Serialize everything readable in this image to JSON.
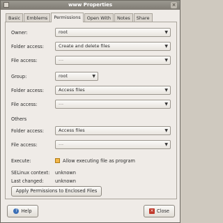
{
  "window": {
    "title": "www Properties",
    "close_glyph": "×"
  },
  "tabs": [
    {
      "label": "Basic"
    },
    {
      "label": "Emblems"
    },
    {
      "label": "Permissions"
    },
    {
      "label": "Open With"
    },
    {
      "label": "Notes"
    },
    {
      "label": "Share"
    }
  ],
  "owner": {
    "label": "Owner:",
    "value": "root"
  },
  "owner_folder_access": {
    "label": "Folder access:",
    "value": "Create and delete files"
  },
  "owner_file_access": {
    "label": "File access:",
    "value": "---"
  },
  "group": {
    "label": "Group:",
    "value": "root"
  },
  "group_folder_access": {
    "label": "Folder access:",
    "value": "Access files"
  },
  "group_file_access": {
    "label": "File access:",
    "value": "---"
  },
  "others": {
    "label": "Others"
  },
  "others_folder_access": {
    "label": "Folder access:",
    "value": "Access files"
  },
  "others_file_access": {
    "label": "File access:",
    "value": "---"
  },
  "execute": {
    "label": "Execute:",
    "checkbox_label": "Allow executing file as program",
    "checked": false
  },
  "selinux": {
    "label": "SELinux context:",
    "value": "unknown"
  },
  "last_changed": {
    "label": "Last changed:",
    "value": "unknown"
  },
  "apply_button": {
    "label": "Apply Permissions to Enclosed Files"
  },
  "help_button": {
    "label": "Help",
    "icon": "help-icon",
    "glyph": "?"
  },
  "close_button": {
    "label": "Close",
    "icon": "close-icon",
    "glyph": "×"
  },
  "dropdown_glyph": "▼",
  "colors": {
    "titlebar": "#8a867e",
    "background": "#efebe7",
    "checkbox": "#f3b64a"
  }
}
